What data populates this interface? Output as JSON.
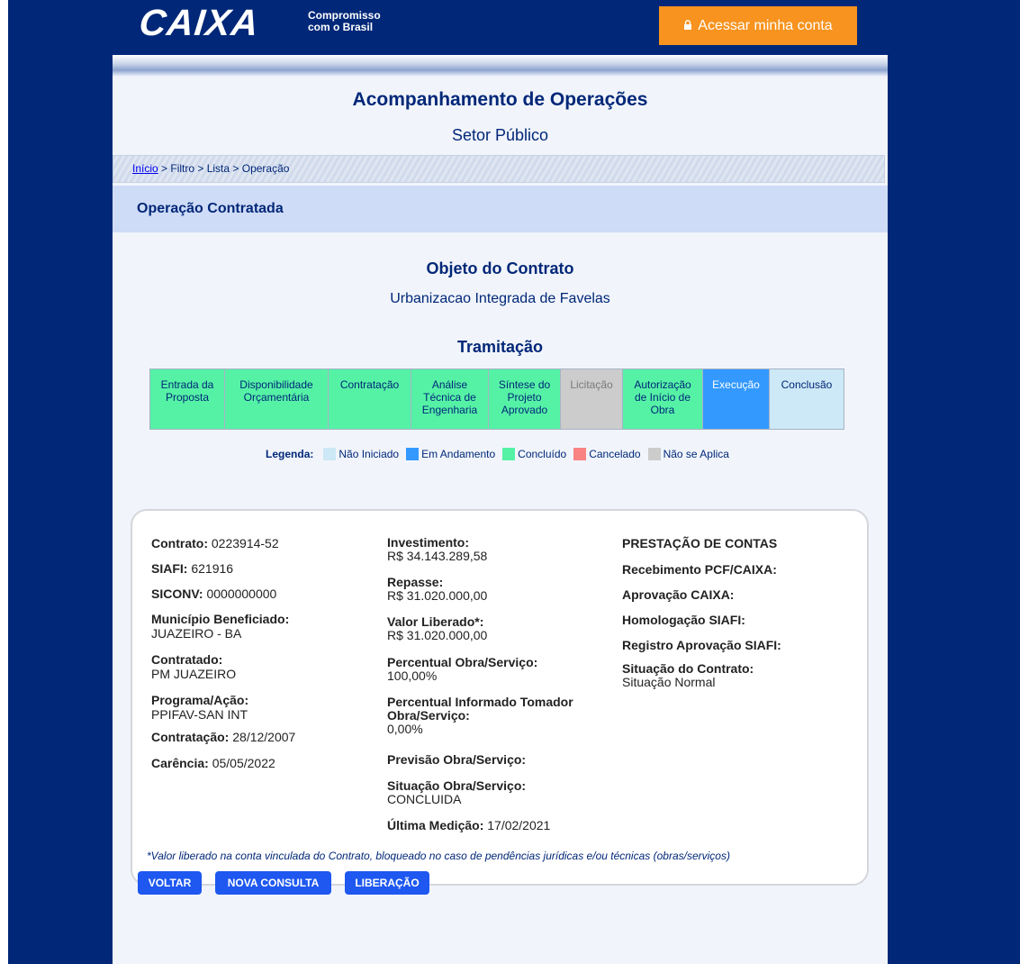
{
  "header": {
    "logo": "CAIXA",
    "tagline_line1": "Compromisso",
    "tagline_line2": "com o Brasil",
    "account_button": "Acessar minha conta"
  },
  "page": {
    "title": "Acompanhamento de Operações",
    "subtitle": "Setor Público"
  },
  "breadcrumb": {
    "home": "Início",
    "rest": " > Filtro > Lista > Operação"
  },
  "section": {
    "title": "Operação Contratada"
  },
  "contract_object": {
    "title": "Objeto do Contrato",
    "value": "Urbanizacao Integrada de Favelas"
  },
  "tramitacao": {
    "title": "Tramitação",
    "steps": [
      {
        "label": "Entrada da Proposta",
        "status": "concluido"
      },
      {
        "label": "Disponibilidade Orçamentária",
        "status": "concluido"
      },
      {
        "label": "Contratação",
        "status": "concluido"
      },
      {
        "label": "Análise Técnica de Engenharia",
        "status": "concluido"
      },
      {
        "label": "Síntese do Projeto Aprovado",
        "status": "concluido"
      },
      {
        "label": "Licitação",
        "status": "nao_se_aplica"
      },
      {
        "label": "Autorização de Início de Obra",
        "status": "concluido"
      },
      {
        "label": "Execução",
        "status": "em_andamento"
      },
      {
        "label": "Conclusão",
        "status": "nao_iniciado"
      }
    ]
  },
  "legend": {
    "title": "Legenda:",
    "items": [
      {
        "label": "Não Iniciado",
        "color": "#cde8f6"
      },
      {
        "label": "Em Andamento",
        "color": "#3399ff"
      },
      {
        "label": "Concluído",
        "color": "#55f2a6"
      },
      {
        "label": "Cancelado",
        "color": "#f98383"
      },
      {
        "label": "Não se Aplica",
        "color": "#cccccc"
      }
    ]
  },
  "colors": {
    "concluido": "#55f2a6",
    "em_andamento": "#3399ff",
    "nao_iniciado": "#cde8f6",
    "nao_se_aplica": "#cccccc",
    "cancelado": "#f98383"
  },
  "details": {
    "contrato_label": "Contrato:",
    "contrato": "0223914-52",
    "siafi_label": "SIAFI:",
    "siafi": "621916",
    "siconv_label": "SICONV:",
    "siconv": "0000000000",
    "municipio_label": "Município Beneficiado:",
    "municipio": "JUAZEIRO - BA",
    "contratado_label": "Contratado:",
    "contratado": "PM JUAZEIRO",
    "programa_label": "Programa/Ação:",
    "programa": "PPIFAV-SAN INT",
    "contratacao_label": "Contratação:",
    "contratacao": "28/12/2007",
    "carencia_label": "Carência:",
    "carencia": "05/05/2022",
    "investimento_label": "Investimento:",
    "investimento": "R$ 34.143.289,58",
    "repasse_label": "Repasse:",
    "repasse": "R$ 31.020.000,00",
    "valor_liberado_label": "Valor Liberado*:",
    "valor_liberado": "R$ 31.020.000,00",
    "percentual_obra_label": "Percentual Obra/Serviço:",
    "percentual_obra": "100,00%",
    "percentual_tomador_label_1": "Percentual Informado Tomador",
    "percentual_tomador_label_2": "Obra/Serviço:",
    "percentual_tomador": "0,00%",
    "previsao_label": "Previsão Obra/Serviço:",
    "situacao_obra_label": "Situação Obra/Serviço:",
    "situacao_obra": "CONCLUIDA",
    "ultima_medicao_label": "Última Medição:",
    "ultima_medicao": "17/02/2021",
    "prestacao_title": "PRESTAÇÃO DE CONTAS",
    "recebimento_label": "Recebimento PCF/CAIXA:",
    "aprovacao_label": "Aprovação CAIXA:",
    "homologacao_label": "Homologação SIAFI:",
    "registro_label": "Registro Aprovação SIAFI:",
    "situacao_contrato_label": "Situação do Contrato:",
    "situacao_contrato": "Situação Normal",
    "footnote": "*Valor liberado na conta vinculada do Contrato, bloqueado no caso de pendências jurídicas e/ou técnicas (obras/serviços)"
  },
  "buttons": {
    "voltar": "VOLTAR",
    "nova_consulta": "NOVA CONSULTA",
    "liberacao": "LIBERAÇÃO"
  }
}
